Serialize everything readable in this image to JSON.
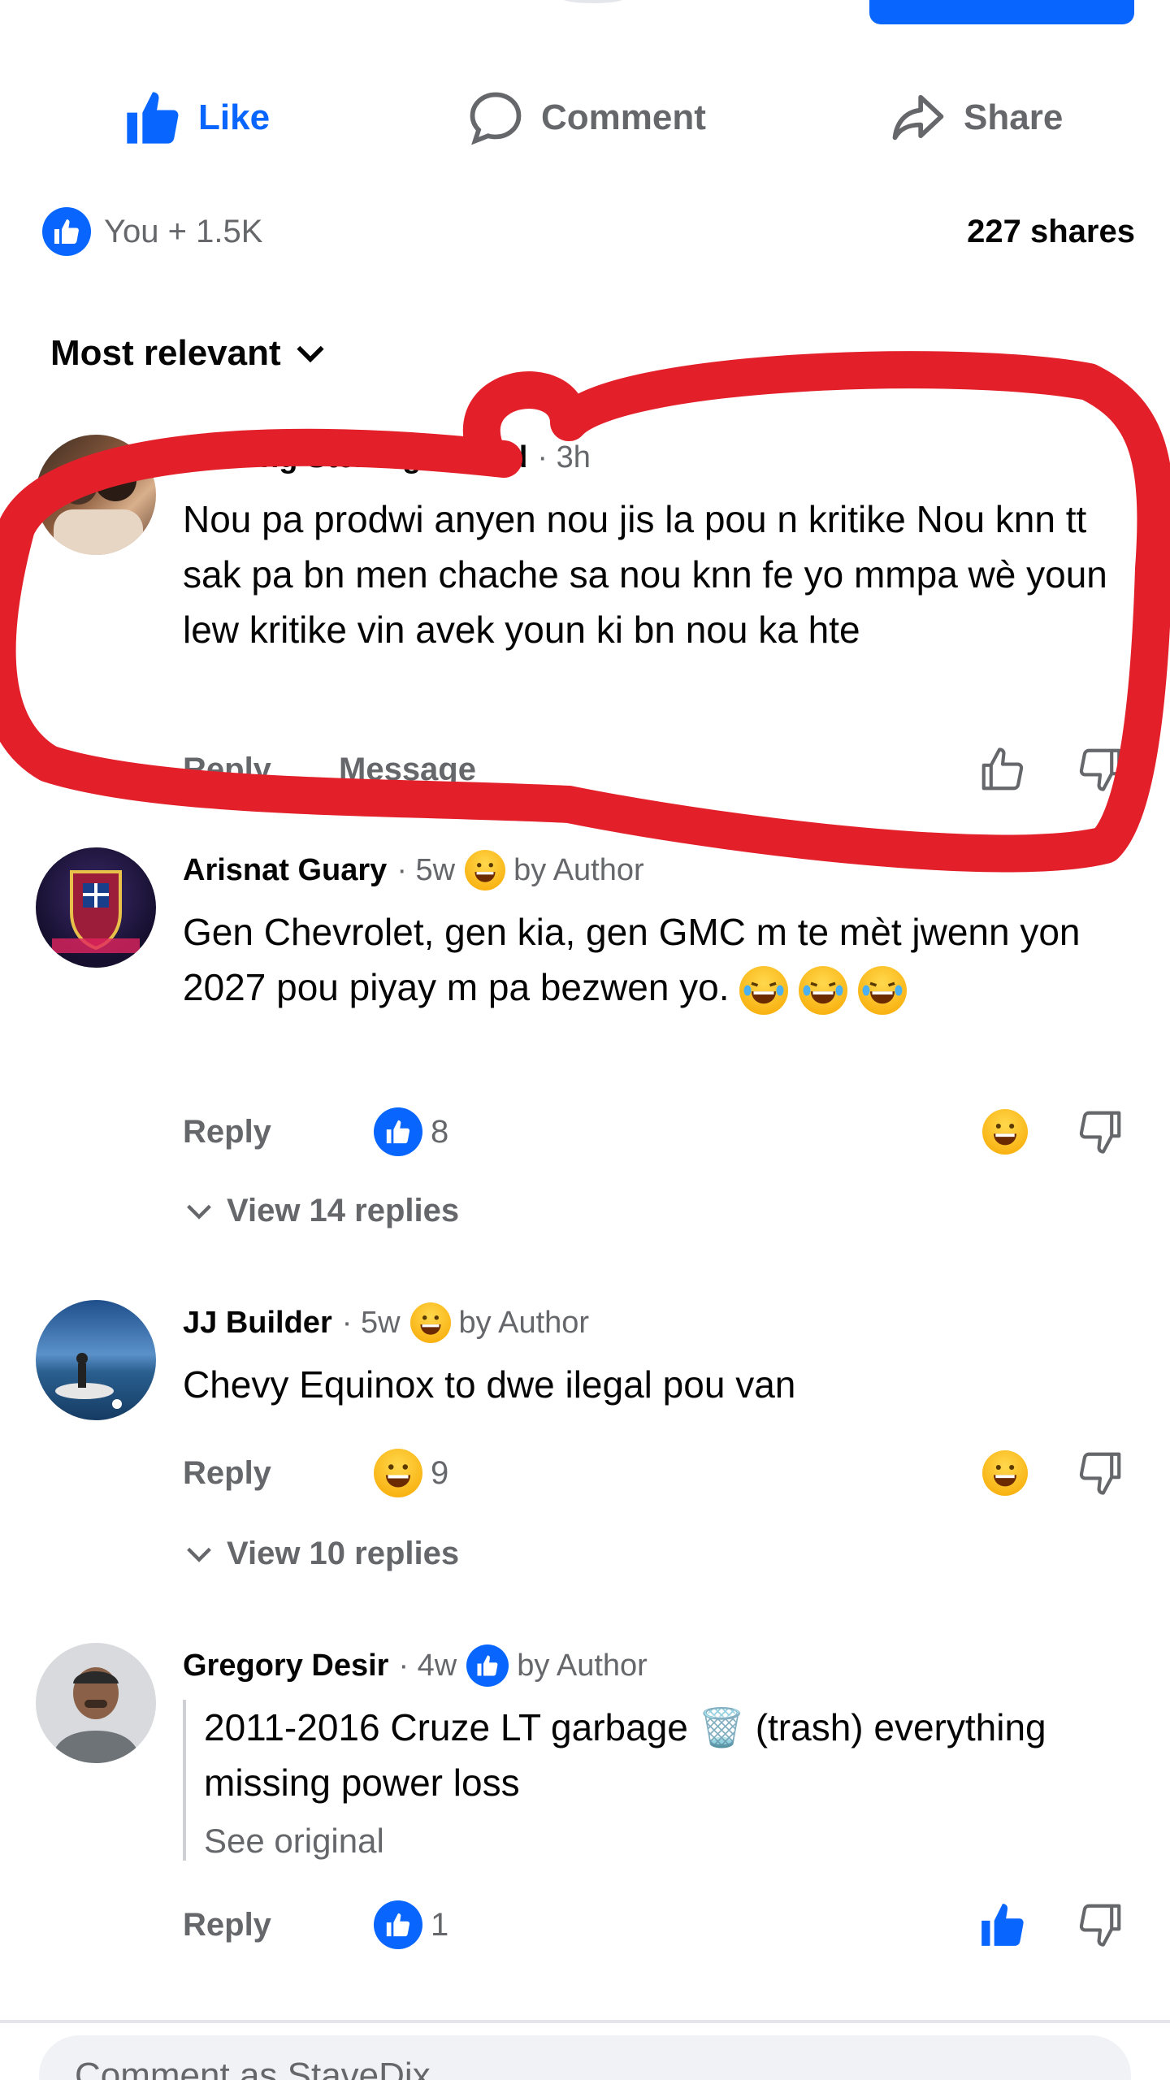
{
  "actions": {
    "like_label": "Like",
    "comment_label": "Comment",
    "share_label": "Share"
  },
  "reactions": {
    "summary": "You + 1.5K",
    "shares": "227 shares"
  },
  "sort": {
    "label": "Most relevant"
  },
  "comments": [
    {
      "name": "Sterling Sterling Ber   nd",
      "time": "· 3h",
      "text": "Nou pa prodwi anyen  nou jis la pou n kritike Nou knn tt sak pa bn men chache sa nou knn fe yo mmpa wè youn  lew kritike vin avek youn ki bn nou ka hte",
      "reply": "Reply",
      "message": "Message"
    },
    {
      "name": "Arisnat Guary",
      "time": "· 5w",
      "author_badge": "by Author",
      "text": "Gen Chevrolet, gen kia, gen GMC m te mèt jwenn yon 2027 pou piyay  m pa bezwen yo.",
      "reply": "Reply",
      "reaction_count": "8",
      "view_replies": "View 14 replies"
    },
    {
      "name": "JJ Builder",
      "time": "· 5w",
      "author_badge": "by Author",
      "text": "Chevy Equinox to dwe ilegal pou van",
      "reply": "Reply",
      "reaction_count": "9",
      "view_replies": "View 10 replies"
    },
    {
      "name": "Gregory Desir",
      "time": "· 4w",
      "author_badge": "by Author",
      "text": "2011-2016 Cruze LT garbage 🗑️ (trash) everything missing power loss",
      "see_original": "See original",
      "reply": "Reply",
      "reaction_count": "1"
    }
  ],
  "composer": {
    "placeholder": "Comment as StaveDix"
  },
  "colors": {
    "accent": "#0866ff",
    "muted_text": "#65676b",
    "annotation_red": "#e3202a"
  }
}
